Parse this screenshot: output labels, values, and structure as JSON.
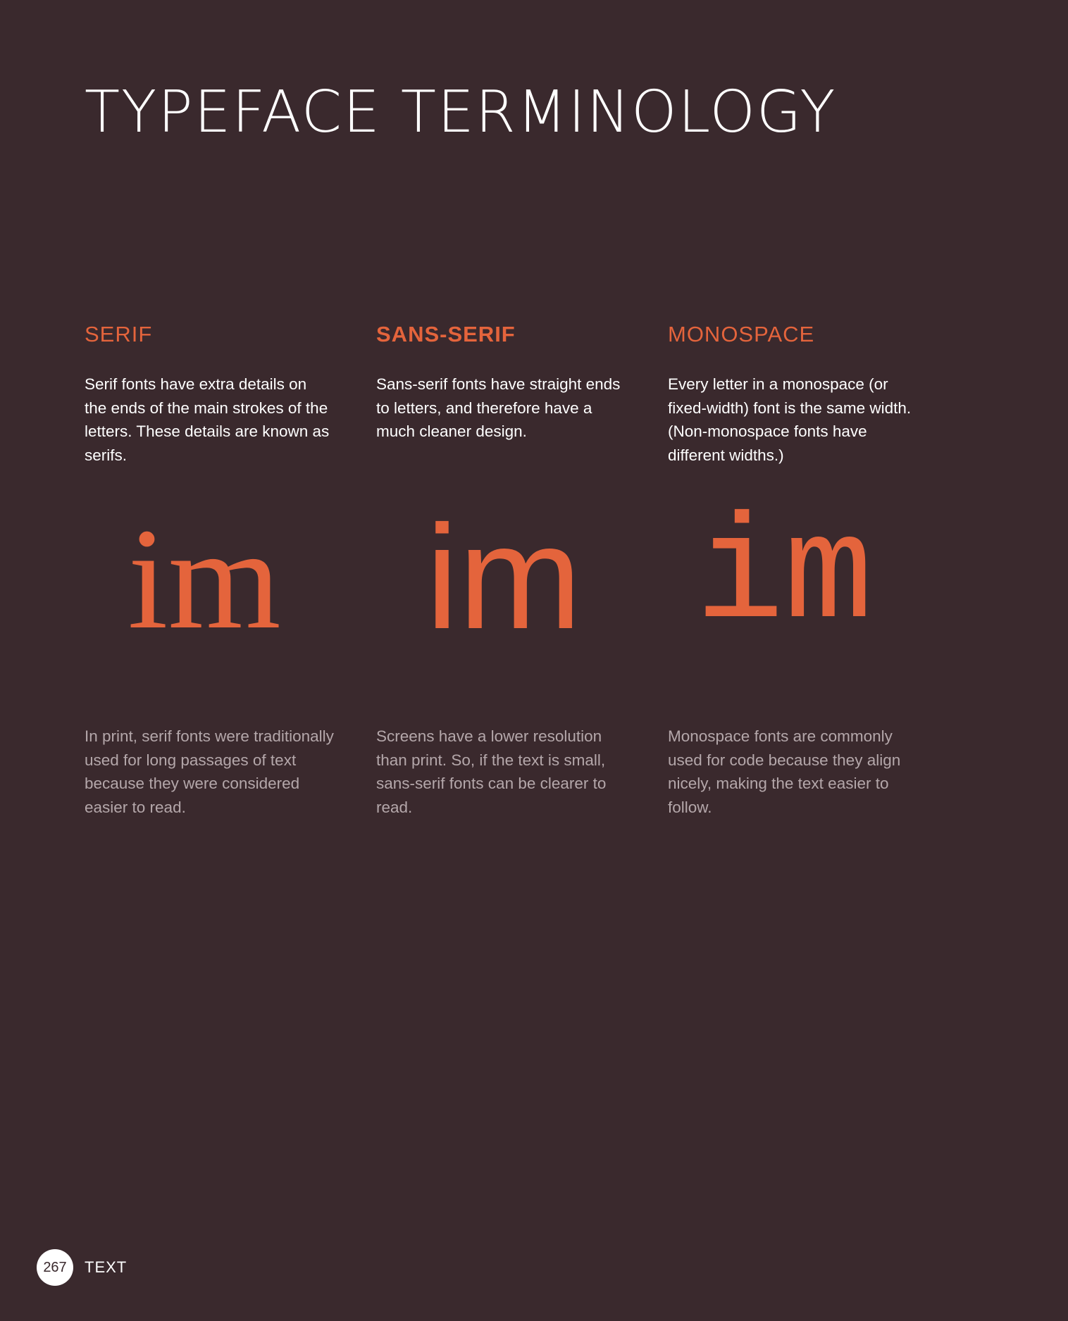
{
  "page": {
    "title": "TYPEFACE TERMINOLOGY",
    "background_color": "#3a292d",
    "accent_color": "#e4643c"
  },
  "columns": [
    {
      "heading": "SERIF",
      "description": "Serif fonts have extra details on the ends of the main strokes of the letters. These details are known as serifs.",
      "sample": "im",
      "note": "In print, serif fonts were traditionally used for long passages of text because they were considered easier to read."
    },
    {
      "heading": "SANS-SERIF",
      "description": "Sans-serif fonts have straight ends to letters, and therefore have a much cleaner design.",
      "sample": "im",
      "note": "Screens have a lower resolution than print. So, if the text is small, sans-serif fonts can be clearer to read."
    },
    {
      "heading": "MONOSPACE",
      "description": "Every letter in a monospace (or fixed-width) font is the same width. (Non-monospace fonts have different widths.)",
      "sample": "im",
      "note": "Monospace fonts are commonly used for code because they align nicely, making the text easier to follow."
    }
  ],
  "footer": {
    "page_number": "267",
    "section": "TEXT"
  }
}
